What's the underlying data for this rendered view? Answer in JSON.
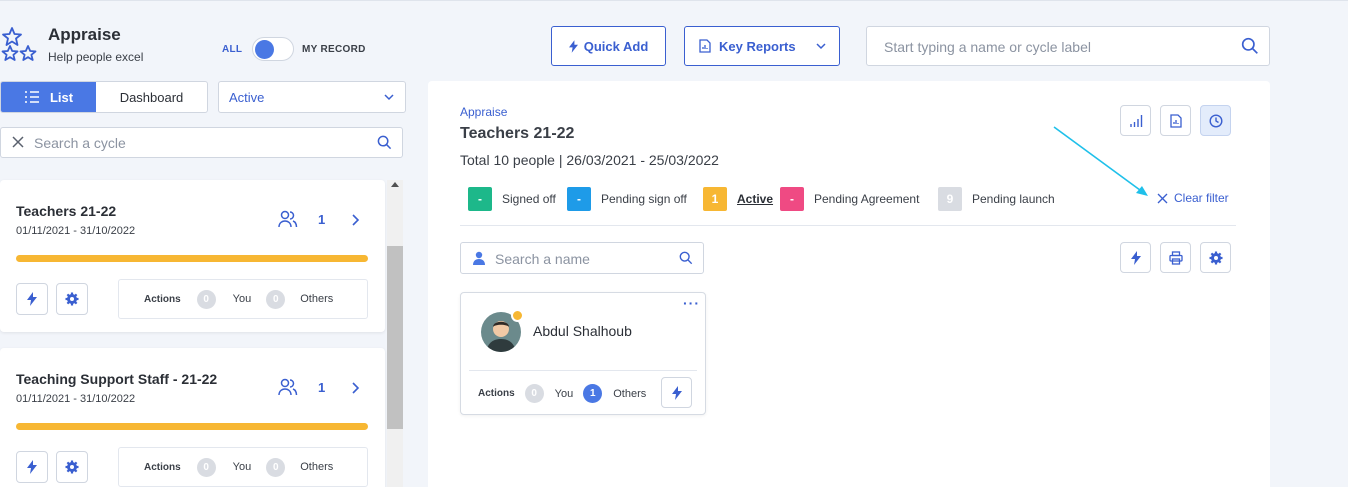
{
  "app": {
    "title": "Appraise",
    "subtitle": "Help people excel"
  },
  "toggle": {
    "left_label": "ALL",
    "right_label": "MY RECORD",
    "state": "ALL"
  },
  "view_tabs": {
    "list_label": "List",
    "dashboard_label": "Dashboard",
    "selected": "List"
  },
  "status_filter": {
    "value": "Active"
  },
  "cycle_search": {
    "placeholder": "Search a cycle"
  },
  "cycles": [
    {
      "title": "Teachers 21-22",
      "dates": "01/11/2021 - 31/10/2022",
      "count": "1",
      "progress": 1.0,
      "actions_label": "Actions",
      "you_count": "0",
      "you_label": "You",
      "others_count": "0",
      "others_label": "Others"
    },
    {
      "title": "Teaching Support Staff - 21-22",
      "dates": "01/11/2021 - 31/10/2022",
      "count": "1",
      "progress": 1.0,
      "actions_label": "Actions",
      "you_count": "0",
      "you_label": "You",
      "others_count": "0",
      "others_label": "Others"
    }
  ],
  "toolbar": {
    "quick_add": "Quick Add",
    "key_reports": "Key Reports"
  },
  "global_search": {
    "placeholder": "Start typing a name or cycle label"
  },
  "detail": {
    "breadcrumb": "Appraise",
    "title": "Teachers 21-22",
    "meta": "Total 10 people | 26/03/2021 - 25/03/2022",
    "legend": [
      {
        "count": "-",
        "label": "Signed off",
        "color": "#1db88a",
        "active": false
      },
      {
        "count": "-",
        "label": "Pending sign off",
        "color": "#1e9be8",
        "active": false
      },
      {
        "count": "1",
        "label": "Active",
        "color": "#f7b733",
        "active": true
      },
      {
        "count": "-",
        "label": "Pending Agreement",
        "color": "#ef4a83",
        "active": false
      },
      {
        "count": "9",
        "label": "Pending launch",
        "color": "#d9dce2",
        "active": false
      }
    ],
    "clear_filter": "Clear filter",
    "name_search_placeholder": "Search a name",
    "person": {
      "name": "Abdul Shalhoub",
      "more": "···",
      "actions_label": "Actions",
      "you_count": "0",
      "you_label": "You",
      "others_count": "1",
      "others_label": "Others"
    }
  },
  "colors": {
    "accent": "#4a78e4",
    "link": "#3a5fd0",
    "progress": "#f7b733",
    "annotation_arrow": "#1fc0ea"
  }
}
